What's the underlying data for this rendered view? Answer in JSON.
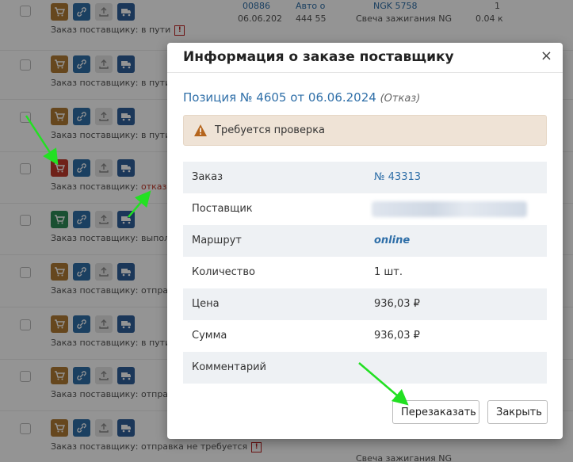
{
  "background": {
    "status_prefix": "Заказ поставщику:",
    "rows": [
      {
        "status": "в пути",
        "warn": true,
        "cart": "normal",
        "info_id": "00886",
        "info_date": "06.06.202",
        "info_auto": "Авто о",
        "info_code": "444 55",
        "info_part": "NGK 5758",
        "info_name": "Свеча зажигания NG",
        "info_qty": "1",
        "info_price": "0.04 к"
      },
      {
        "status": "в пути",
        "warn": false,
        "cart": "normal"
      },
      {
        "status": "в пути",
        "warn": false,
        "cart": "normal"
      },
      {
        "status": "отказ",
        "warn": false,
        "cart": "red"
      },
      {
        "status": "выпол",
        "warn": false,
        "cart": "green"
      },
      {
        "status": "отправ",
        "warn": false,
        "cart": "normal"
      },
      {
        "status": "в пути",
        "warn": false,
        "cart": "normal"
      },
      {
        "status": "отправ",
        "warn": false,
        "cart": "normal"
      },
      {
        "status": "отправка не требуется",
        "warn": true,
        "cart": "normal",
        "info_part": "Свеча зажигания NG"
      }
    ],
    "warn_symbol": "!"
  },
  "modal": {
    "title": "Информация о заказе поставщику",
    "close_symbol": "×",
    "position_title": "Позиция № 4605 от 06.06.2024",
    "position_status": "(Отказ)",
    "alert_text": "Требуется проверка",
    "rows": [
      {
        "label": "Заказ",
        "value": "№ 43313"
      },
      {
        "label": "Поставщик",
        "value": ""
      },
      {
        "label": "Маршрут",
        "value": "online"
      },
      {
        "label": "Количество",
        "value": "1 шт."
      },
      {
        "label": "Цена",
        "value": "936,03 ₽"
      },
      {
        "label": "Сумма",
        "value": "936,03 ₽"
      },
      {
        "label": "Комментарий",
        "value": ""
      }
    ],
    "reorder_label": "Перезаказать",
    "close_label": "Закрыть"
  },
  "colors": {
    "link": "#2f6fa8",
    "alert_bg": "#efe3d6",
    "arrow": "#22e022"
  }
}
